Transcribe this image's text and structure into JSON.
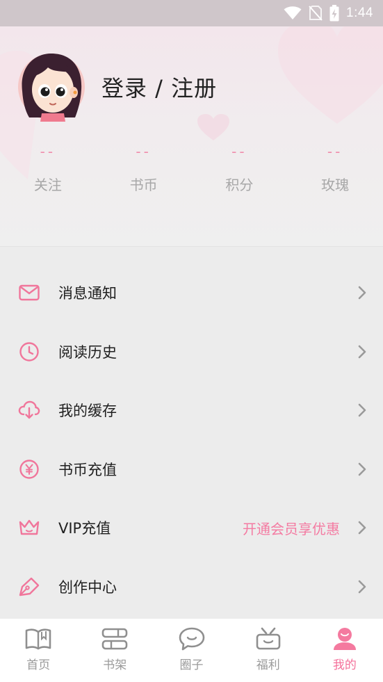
{
  "status_bar": {
    "time": "1:44"
  },
  "header": {
    "login_label": "登录 / 注册",
    "stats": [
      {
        "value": "--",
        "label": "关注"
      },
      {
        "value": "--",
        "label": "书币"
      },
      {
        "value": "--",
        "label": "积分"
      },
      {
        "value": "--",
        "label": "玫瑰"
      }
    ]
  },
  "menu": {
    "items": [
      {
        "label": "消息通知",
        "icon": "mail-icon"
      },
      {
        "label": "阅读历史",
        "icon": "clock-icon"
      },
      {
        "label": "我的缓存",
        "icon": "cloud-download-icon"
      },
      {
        "label": "书币充值",
        "icon": "yen-coin-icon"
      },
      {
        "label": "VIP充值",
        "icon": "crown-icon",
        "extra": "开通会员享优惠"
      },
      {
        "label": "创作中心",
        "icon": "pen-icon"
      }
    ]
  },
  "tabbar": {
    "tabs": [
      {
        "label": "首页",
        "icon": "book-icon",
        "active": false
      },
      {
        "label": "书架",
        "icon": "bookshelf-icon",
        "active": false
      },
      {
        "label": "圈子",
        "icon": "chat-icon",
        "active": false
      },
      {
        "label": "福利",
        "icon": "gift-icon",
        "active": false
      },
      {
        "label": "我的",
        "icon": "profile-icon",
        "active": true
      }
    ]
  },
  "colors": {
    "accent": "#f4709a",
    "icon_pink": "#f0769b",
    "inactive": "#9a9a9a"
  }
}
